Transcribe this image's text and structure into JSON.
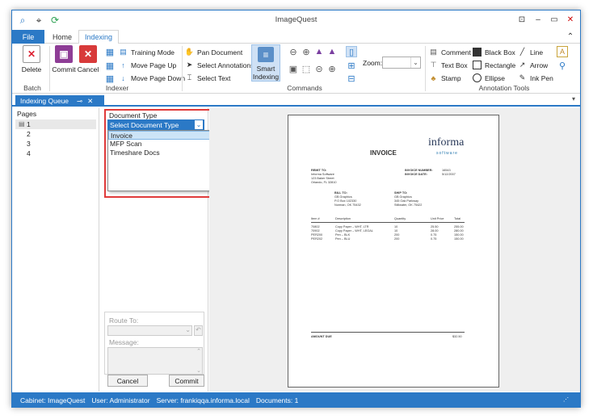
{
  "window": {
    "title": "ImageQuest"
  },
  "ribbon_tabs": {
    "file": "File",
    "home": "Home",
    "indexing": "Indexing"
  },
  "groups": {
    "batch": "Batch",
    "indexer": "Indexer",
    "commands": "Commands",
    "annotation_tools": "Annotation Tools"
  },
  "buttons": {
    "delete": "Delete",
    "commit": "Commit",
    "cancel": "Cancel",
    "training_mode": "Training Mode",
    "move_page_up": "Move Page Up",
    "move_page_down": "Move Page Down",
    "pan_document": "Pan Document",
    "select_annotations": "Select Annotations",
    "select_text": "Select Text",
    "smart_indexing_line1": "Smart",
    "smart_indexing_line2": "Indexing",
    "zoom_label": "Zoom:",
    "comment": "Comment",
    "text_box": "Text Box",
    "stamp": "Stamp",
    "black_box": "Black Box",
    "rectangle": "Rectangle",
    "ellipse": "Ellipse",
    "line": "Line",
    "arrow": "Arrow",
    "ink_pen": "Ink Pen"
  },
  "pane": {
    "tab_label": "Indexing Queue",
    "pin": "⊸",
    "close": "✕"
  },
  "pages": {
    "header": "Pages",
    "items": [
      "1",
      "2",
      "3",
      "4"
    ]
  },
  "indexer": {
    "doc_type_label": "Document Type",
    "doc_type_selected": "Select Document Type",
    "options": [
      "Invoice",
      "MFP Scan",
      "Timeshare Docs"
    ],
    "route_to_label": "Route To:",
    "message_label": "Message:",
    "cancel": "Cancel",
    "commit": "Commit"
  },
  "invoice": {
    "title": "INVOICE",
    "logo_main": "informa",
    "logo_sub": "software",
    "remit_to": "REMIT TO:",
    "remit_lines": [
      "Informa Software",
      "123 Baker Street",
      "Orlando, FL 32810"
    ],
    "inv_number_label": "INVOICE NUMBER:",
    "inv_number": "16543",
    "inv_date_label": "INVOICE DATE:",
    "inv_date": "5/12/2007",
    "bill_to": "BILL TO:",
    "bill_lines": [
      "GB Graphics",
      "P.O Box 102330",
      "Norman, OK 75432"
    ],
    "ship_to": "SHIP TO:",
    "ship_lines": [
      "GB Graphics",
      "345 Oak Parkway",
      "Stillwater, OK 75422"
    ],
    "columns": [
      "Item #",
      "Description",
      "Quantity",
      "Unit Price",
      "Total"
    ],
    "rows": [
      [
        "70802",
        "Copy Paper – WHT, LTR",
        "10",
        "25.50",
        "255.00"
      ],
      [
        "70902",
        "Copy Paper – WHT, LEGAL",
        "10",
        "28.00",
        "280.00"
      ],
      [
        "PER200",
        "Pen – BLK",
        "200",
        "0.75",
        "150.00"
      ],
      [
        "PER202",
        "Pen – BLU",
        "200",
        "0.75",
        "150.00"
      ]
    ],
    "amount_due_label": "AMOUNT DUE",
    "amount_due": "$32.50"
  },
  "status": {
    "cabinet": "Cabinet: ImageQuest",
    "user": "User: Administrator",
    "server": "Server: frankiqqa.informa.local",
    "documents": "Documents: 1"
  },
  "colors": {
    "accent": "#2b79c6",
    "highlight_border": "#e03a3a"
  }
}
